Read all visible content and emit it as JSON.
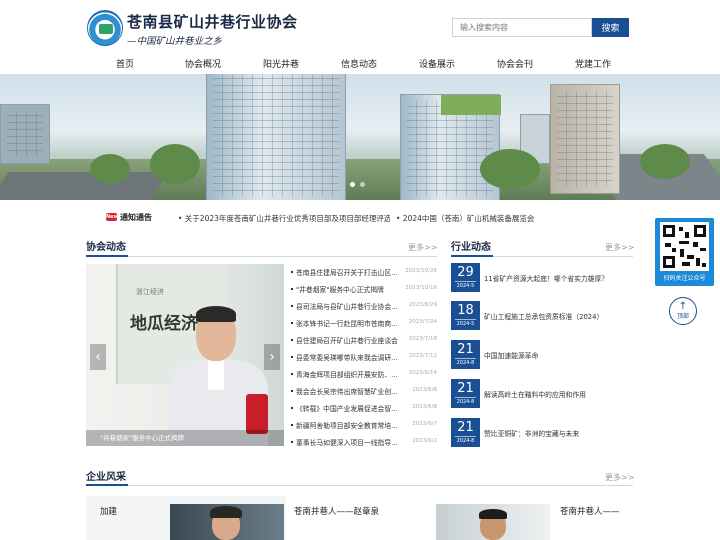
{
  "header": {
    "site_title": "苍南县矿山井巷行业协会",
    "slogan": "—中国矿山井巷业之乡",
    "search_placeholder": "输入搜索内容",
    "search_button": "搜索"
  },
  "nav": {
    "items": [
      "首页",
      "协会概况",
      "阳光井巷",
      "信息动态",
      "设备展示",
      "协会会刊",
      "党建工作"
    ]
  },
  "notice": {
    "title": "通知通告",
    "icon_text": "New",
    "items": [
      "• 关于2023年度苍南矿山井巷行业优秀项目部及项目部经理评选结...",
      "• 2024中国（苍南）矿山机械装备展览会"
    ]
  },
  "association_news": {
    "title": "协会动态",
    "more": "更多>>",
    "feature_caption": "\"井巷烟家\"服务中心正式揭牌",
    "feature_sign": "地瓜经济",
    "feature_sign_small": "浙江经济",
    "rows": [
      {
        "title": "苍南县住建局召开关于打击山区26...",
        "date": "2023/10/26"
      },
      {
        "title": "\"井巷烟家\"服务中心正式揭牌",
        "date": "2023/10/16"
      },
      {
        "title": "县司法局与县矿山井巷行业协会举...",
        "date": "2023/8/29"
      },
      {
        "title": "张本锋书记一行赴昆明市苍南商会...",
        "date": "2023/7/24"
      },
      {
        "title": "县住建局召开矿山井巷行业座谈会",
        "date": "2023/7/18"
      },
      {
        "title": "县委常委吴瑛嘟带队来我会调研指...",
        "date": "2023/7/12"
      },
      {
        "title": "青海金辉项目部组织开展安防、消...",
        "date": "2023/6/14"
      },
      {
        "title": "我会会长吴宗伟出席智慧矿业创新...",
        "date": "2023/6/8"
      },
      {
        "title": "《转载》中国产业发展促进会智慧...",
        "date": "2023/6/8"
      },
      {
        "title": "新疆阿舍勒项目部安全教育常培常新",
        "date": "2023/6/7"
      },
      {
        "title": "董事长马如健深入项目一线指导安...",
        "date": "2023/6/2"
      }
    ]
  },
  "industry_news": {
    "title": "行业动态",
    "more": "更多>>",
    "rows": [
      {
        "day": "29",
        "ym": "2024-5",
        "title": "11省矿产资源大起底！哪个省实力雄厚？"
      },
      {
        "day": "18",
        "ym": "2024-5",
        "title": "矿山工程施工总承包资质标准（2024）"
      },
      {
        "day": "21",
        "ym": "2024-8",
        "title": "中国加速能源革命"
      },
      {
        "day": "21",
        "ym": "2024-8",
        "title": "解读高岭土在釉料中的应用和作用"
      },
      {
        "day": "21",
        "ym": "2024-8",
        "title": "赞比亚铜矿：非洲的宝藏与未来"
      }
    ]
  },
  "side": {
    "qr_label": "扫码关注公众号",
    "top_arrow": "↑",
    "top_label": "顶部"
  },
  "enterprise": {
    "title": "企业风采",
    "more": "更多>>",
    "cards": [
      {
        "text": "加建"
      },
      {
        "text": "苍南井巷人——赵章泉"
      },
      {
        "text": "苍南井巷人——"
      }
    ]
  },
  "colors": {
    "brand_blue": "#1b4f93",
    "qr_blue": "#1b8ad8",
    "notice_red": "#d8232a"
  }
}
